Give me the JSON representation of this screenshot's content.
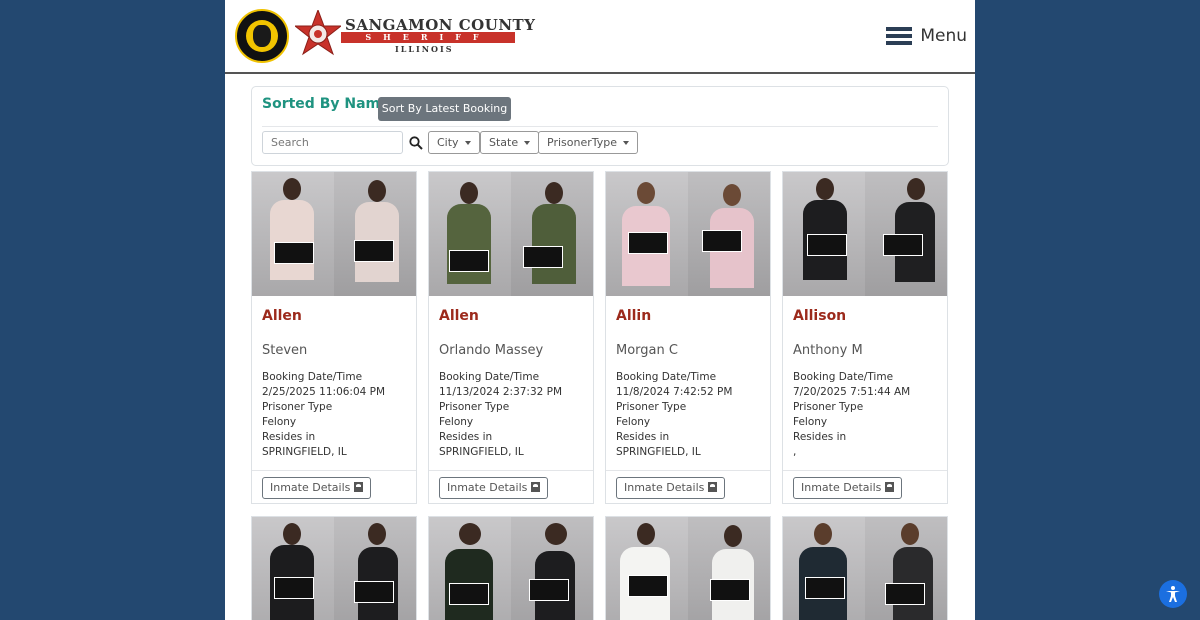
{
  "header": {
    "logo_main": "SANGAMON COUNTY",
    "logo_bar": "SHERIFF",
    "logo_sub": "ILLINOIS",
    "seal_text": "SEAL OF SANGAMON COUNTY ILLINOIS 1821",
    "menu_label": "Menu"
  },
  "filters": {
    "sorted_label": "Sorted By Name",
    "sort_button": "Sort By Latest Booking",
    "search_placeholder": "Search",
    "city_label": "City",
    "state_label": "State",
    "prisoner_type_label": "PrisonerType"
  },
  "inmates": [
    {
      "last": "Allen",
      "first": "Steven",
      "booking_label": "Booking Date/Time",
      "booking": "2/25/2025 11:06:04 PM",
      "type_label": "Prisoner Type",
      "type": "Felony",
      "resides_label": "Resides in",
      "resides": "SPRINGFIELD, IL",
      "button": "Inmate Details"
    },
    {
      "last": "Allen",
      "first": "Orlando Massey",
      "booking_label": "Booking Date/Time",
      "booking": "11/13/2024 2:37:32 PM",
      "type_label": "Prisoner Type",
      "type": "Felony",
      "resides_label": "Resides in",
      "resides": "SPRINGFIELD, IL",
      "button": "Inmate Details"
    },
    {
      "last": "Allin",
      "first": "Morgan C",
      "booking_label": "Booking Date/Time",
      "booking": "11/8/2024 7:42:52 PM",
      "type_label": "Prisoner Type",
      "type": "Felony",
      "resides_label": "Resides in",
      "resides": "SPRINGFIELD, IL",
      "button": "Inmate Details"
    },
    {
      "last": "Allison",
      "first": "Anthony M",
      "booking_label": "Booking Date/Time",
      "booking": "7/20/2025 7:51:44 AM",
      "type_label": "Prisoner Type",
      "type": "Felony",
      "resides_label": "Resides in",
      "resides": ",",
      "button": "Inmate Details"
    }
  ],
  "colors": {
    "background": "#234870",
    "accent_green": "#1f9380",
    "name_red": "#9c2a1c",
    "accessibility_blue": "#1b6fe0"
  }
}
